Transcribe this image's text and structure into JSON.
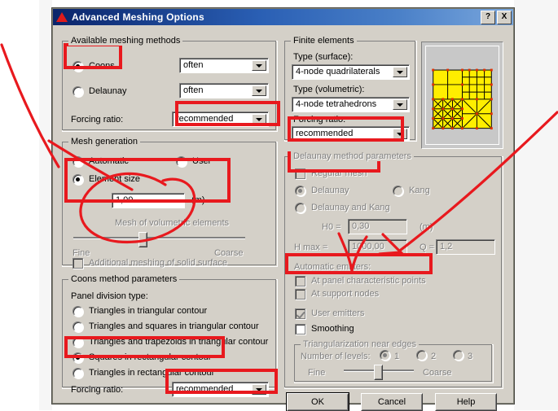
{
  "window": {
    "title": "Advanced Meshing Options",
    "icon": "red-triangle-icon",
    "help_button": "?",
    "close_button": "X"
  },
  "colors": {
    "dialog_face": "#d4d0c8",
    "title_start": "#0a246a",
    "title_end": "#7aa7dd",
    "annotation_red": "#e8191e",
    "mesh_yellow": "#ffee00"
  },
  "available_meshing_methods": {
    "legend": "Available meshing methods",
    "coons": {
      "label": "Coons",
      "selected": true,
      "frequency": "often"
    },
    "delaunay": {
      "label": "Delaunay",
      "selected": false,
      "frequency": "often"
    },
    "forcing_ratio": {
      "label": "Forcing ratio:",
      "value": "recommended"
    }
  },
  "mesh_generation": {
    "legend": "Mesh generation",
    "automatic": "Automatic",
    "user": "User",
    "element_size": "Element size",
    "element_size_value": "1,00",
    "element_size_unit": "(m)",
    "volumetric_label": "Mesh of volumetric elements",
    "fine": "Fine",
    "coarse": "Coarse",
    "additional_meshing": "Additional meshing of solid surface"
  },
  "coons_method_parameters": {
    "legend": "Coons method parameters",
    "panel_division_label": "Panel division type:",
    "options": [
      "Triangles in triangular contour",
      "Triangles and squares in triangular contour",
      "Triangles and trapezoids in triangular contour",
      "Squares in rectangular contour",
      "Triangles in rectangular contour"
    ],
    "selected_index": 3,
    "forcing_ratio": {
      "label": "Forcing ratio:",
      "value": "recommended"
    }
  },
  "finite_elements": {
    "legend": "Finite elements",
    "type_surface_label": "Type (surface):",
    "type_surface_value": "4-node quadrilaterals",
    "type_volumetric_label": "Type (volumetric):",
    "type_volumetric_value": "4-node tetrahedrons",
    "forcing_ratio_label": "Forcing ratio:",
    "forcing_ratio_value": "recommended"
  },
  "preview": {
    "name": "mesh-preview"
  },
  "delaunay_method_parameters": {
    "legend": "Delaunay method parameters",
    "regular_mesh": "Regular mesh",
    "delaunay": "Delaunay",
    "kang": "Kang",
    "delaunay_and_kang": "Delaunay and Kang",
    "h0_label": "H0 =",
    "h0_value": "0,30",
    "h0_unit": "(m)",
    "hmax_label": "H max =",
    "hmax_value": "1000,00",
    "q_label": "Q =",
    "q_value": "1,2"
  },
  "automatic_emitters": {
    "legend": "Automatic emitters:",
    "at_panel_characteristic_points": "At panel characteristic points",
    "at_support_nodes": "At support nodes",
    "user_emitters": "User emitters",
    "smoothing": "Smoothing"
  },
  "triangularization": {
    "legend": "Triangularization near edges",
    "number_of_levels_label": "Number of levels:",
    "levels": [
      "1",
      "2",
      "3"
    ],
    "selected_level": 0,
    "fine": "Fine",
    "coarse": "Coarse"
  },
  "buttons": {
    "ok": "OK",
    "cancel": "Cancel",
    "help": "Help"
  }
}
